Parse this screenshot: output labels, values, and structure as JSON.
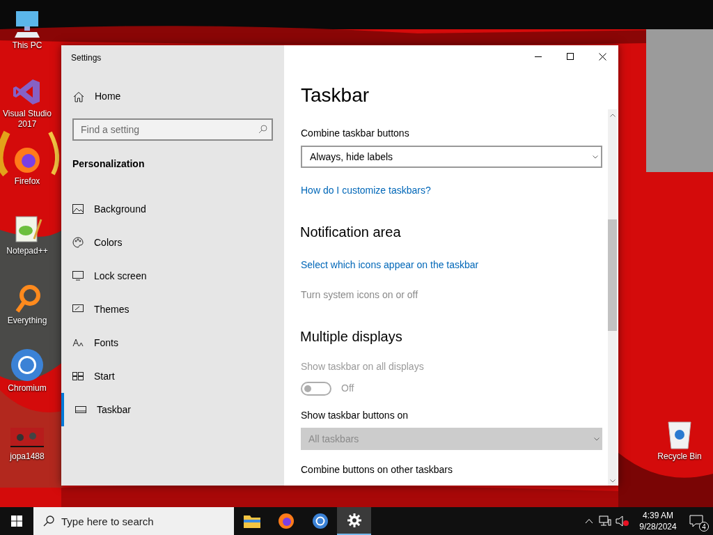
{
  "desktop_icons": [
    {
      "label": "This PC"
    },
    {
      "label": "Visual Studio 2017"
    },
    {
      "label": "Firefox"
    },
    {
      "label": "Notepad++"
    },
    {
      "label": "Everything"
    },
    {
      "label": "Chromium"
    },
    {
      "label": "jopa1488"
    },
    {
      "label": "Recycle Bin"
    }
  ],
  "window": {
    "title": "Settings"
  },
  "sidebar": {
    "home": "Home",
    "search": {
      "placeholder": "Find a setting"
    },
    "section": "Personalization",
    "items": [
      {
        "label": "Background",
        "selected": false
      },
      {
        "label": "Colors",
        "selected": false
      },
      {
        "label": "Lock screen",
        "selected": false
      },
      {
        "label": "Themes",
        "selected": false
      },
      {
        "label": "Fonts",
        "selected": false
      },
      {
        "label": "Start",
        "selected": false
      },
      {
        "label": "Taskbar",
        "selected": true
      }
    ]
  },
  "page": {
    "title": "Taskbar",
    "content": [
      {
        "kind": "label",
        "text": "Combine taskbar buttons",
        "disabled": false
      },
      {
        "kind": "dropdown",
        "value": "Always, hide labels",
        "disabled": false
      },
      {
        "kind": "link",
        "text": "How do I customize taskbars?",
        "disabled": false
      },
      {
        "kind": "heading",
        "text": "Notification area"
      },
      {
        "kind": "link",
        "text": "Select which icons appear on the taskbar",
        "disabled": false
      },
      {
        "kind": "link",
        "text": "Turn system icons on or off",
        "disabled": true
      },
      {
        "kind": "heading",
        "text": "Multiple displays"
      },
      {
        "kind": "label",
        "text": "Show taskbar on all displays",
        "disabled": true
      },
      {
        "kind": "toggle",
        "on": false,
        "state_label": "Off",
        "disabled": true
      },
      {
        "kind": "label",
        "text": "Show taskbar buttons on",
        "disabled": false
      },
      {
        "kind": "dropdown",
        "value": "All taskbars",
        "disabled": true
      },
      {
        "kind": "label",
        "text": "Combine buttons on other taskbars",
        "disabled": false
      }
    ]
  },
  "taskbar": {
    "search": {
      "placeholder": "Type here to search"
    },
    "apps": [
      {
        "selected": false
      },
      {
        "selected": false
      },
      {
        "selected": false
      },
      {
        "selected": true
      }
    ],
    "time": "4:39 AM",
    "date": "9/28/2024",
    "notifications": "4"
  }
}
